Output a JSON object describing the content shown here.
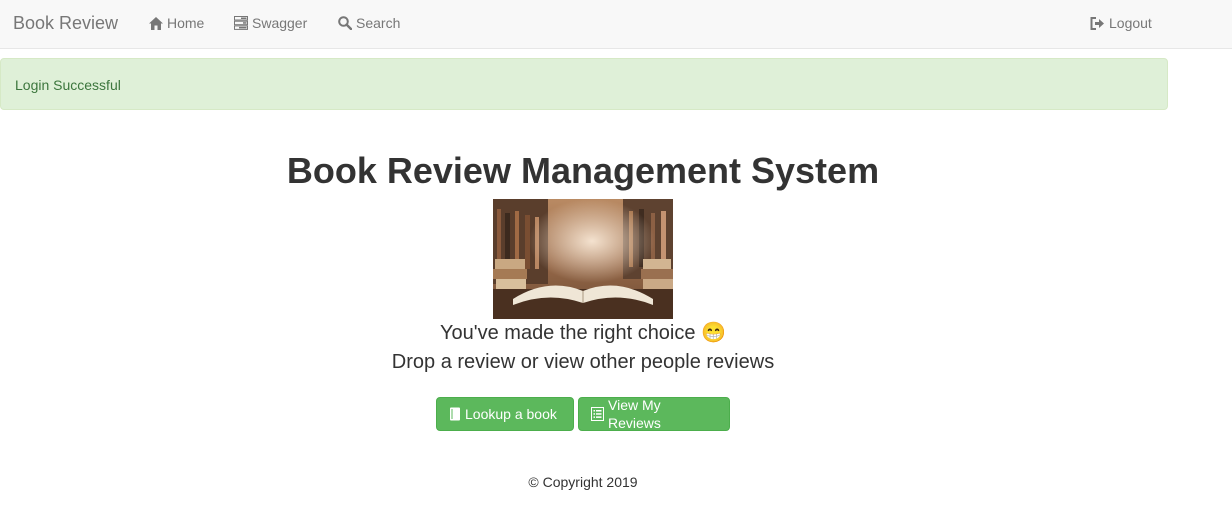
{
  "navbar": {
    "brand": "Book Review",
    "home_label": "Home",
    "swagger_label": "Swagger",
    "search_label": "Search",
    "logout_label": "Logout"
  },
  "alert": {
    "message": "Login Successful",
    "type": "success"
  },
  "main": {
    "title": "Book Review Management System",
    "image_alt": "Open book in library",
    "tagline_line1": "You've made the right choice 😁",
    "tagline_line2": "Drop a review or view other people reviews",
    "lookup_button": "Lookup a book",
    "reviews_button": "View My Reviews"
  },
  "footer": {
    "copyright": "© Copyright 2019"
  },
  "icons": {
    "home": "home-icon",
    "swagger": "tasks-icon",
    "search": "search-icon",
    "logout": "logout-icon",
    "book": "book-icon",
    "list": "list-icon"
  },
  "colors": {
    "navbar_bg": "#f8f8f8",
    "nav_text": "#777777",
    "alert_bg": "#dff0d8",
    "alert_text": "#3c763d",
    "button_success": "#5cb85c"
  }
}
